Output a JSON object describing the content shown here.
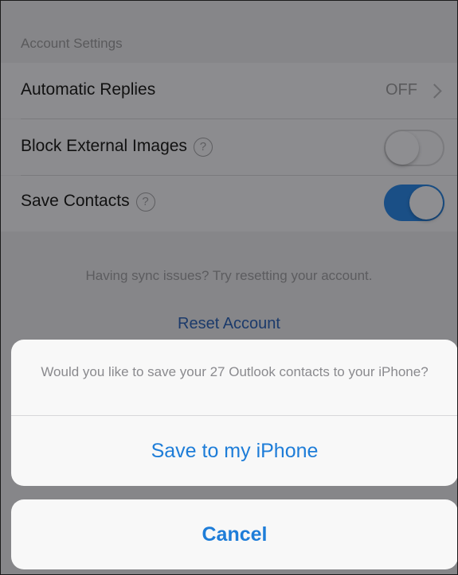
{
  "settings": {
    "section_header": "Account Settings",
    "rows": [
      {
        "label": "Automatic Replies",
        "value": "OFF"
      },
      {
        "label": "Block External Images",
        "help": "?",
        "toggle": "off"
      },
      {
        "label": "Save Contacts",
        "help": "?",
        "toggle": "on"
      }
    ],
    "sync_text": "Having sync issues? Try resetting your account.",
    "reset_label": "Reset Account"
  },
  "action_sheet": {
    "message": "Would you like to save your 27 Outlook contacts to your iPhone?",
    "action_label": "Save to my iPhone",
    "cancel_label": "Cancel"
  },
  "colors": {
    "accent": "#1e7dd8",
    "toggle_on": "#1a4f86"
  }
}
